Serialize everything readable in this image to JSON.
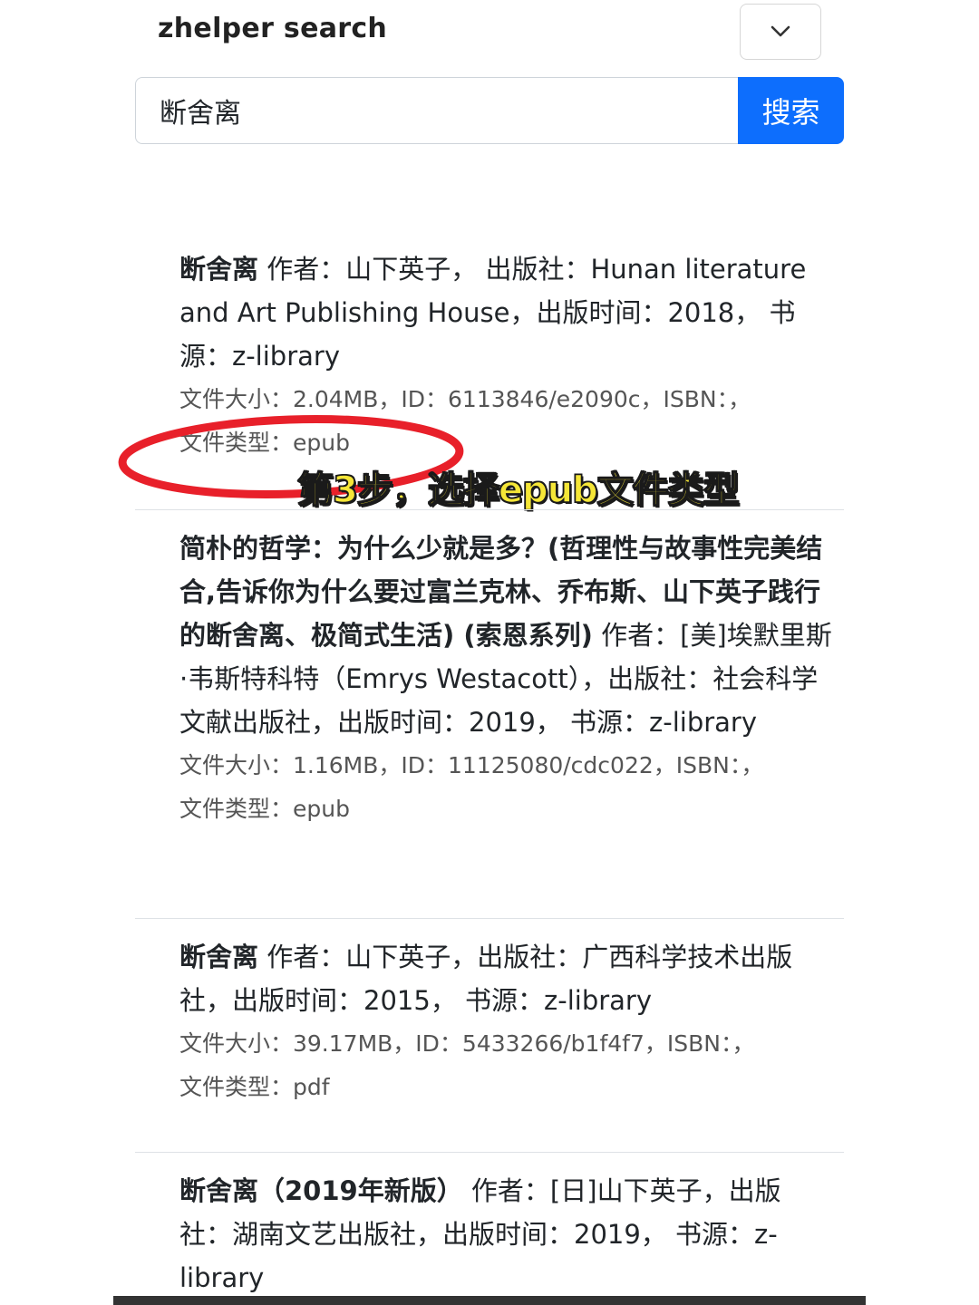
{
  "header": {
    "brand": "zhelper search",
    "toggle_icon": "chevron-down-icon"
  },
  "search": {
    "value": "断舍离",
    "button_label": "搜索",
    "button_color": "#0d6efd"
  },
  "annotation": {
    "text": "第3步，选择epub文件类型",
    "oval_color": "#e8202a",
    "text_color": "#f5e637"
  },
  "results": [
    {
      "title_bold": "断舍离",
      "title_rest": " 作者：山下英子， 出版社：Hunan literature and Art Publishing House，出版时间：2018， 书源：z-library",
      "meta_line1": "文件大小：2.04MB，ID：6113846/e2090c，ISBN：，",
      "meta_line2": "文件类型：epub"
    },
    {
      "title_bold": "简朴的哲学：为什么少就是多？(哲理性与故事性完美结合,告诉你为什么要过富兰克林、乔布斯、山下英子践行的断舍离、极简式生活) (索恩系列)",
      "title_rest": " 作者：[美]埃默里斯·韦斯特科特（Emrys Westacott），出版社：社会科学文献出版社，出版时间：2019， 书源：z-library",
      "meta_line1": "文件大小：1.16MB，ID：11125080/cdc022，ISBN：，",
      "meta_line2": "文件类型：epub"
    },
    {
      "title_bold": "断舍离",
      "title_rest": " 作者：山下英子，出版社：广西科学技术出版社，出版时间：2015， 书源：z-library",
      "meta_line1": "文件大小：39.17MB，ID：5433266/b1f4f7，ISBN：，",
      "meta_line2": "文件类型：pdf"
    },
    {
      "title_bold": "断舍离（2019年新版）",
      "title_rest": " 作者：[日]山下英子，出版社：湖南文艺出版社，出版时间：2019， 书源：z-library"
    }
  ]
}
